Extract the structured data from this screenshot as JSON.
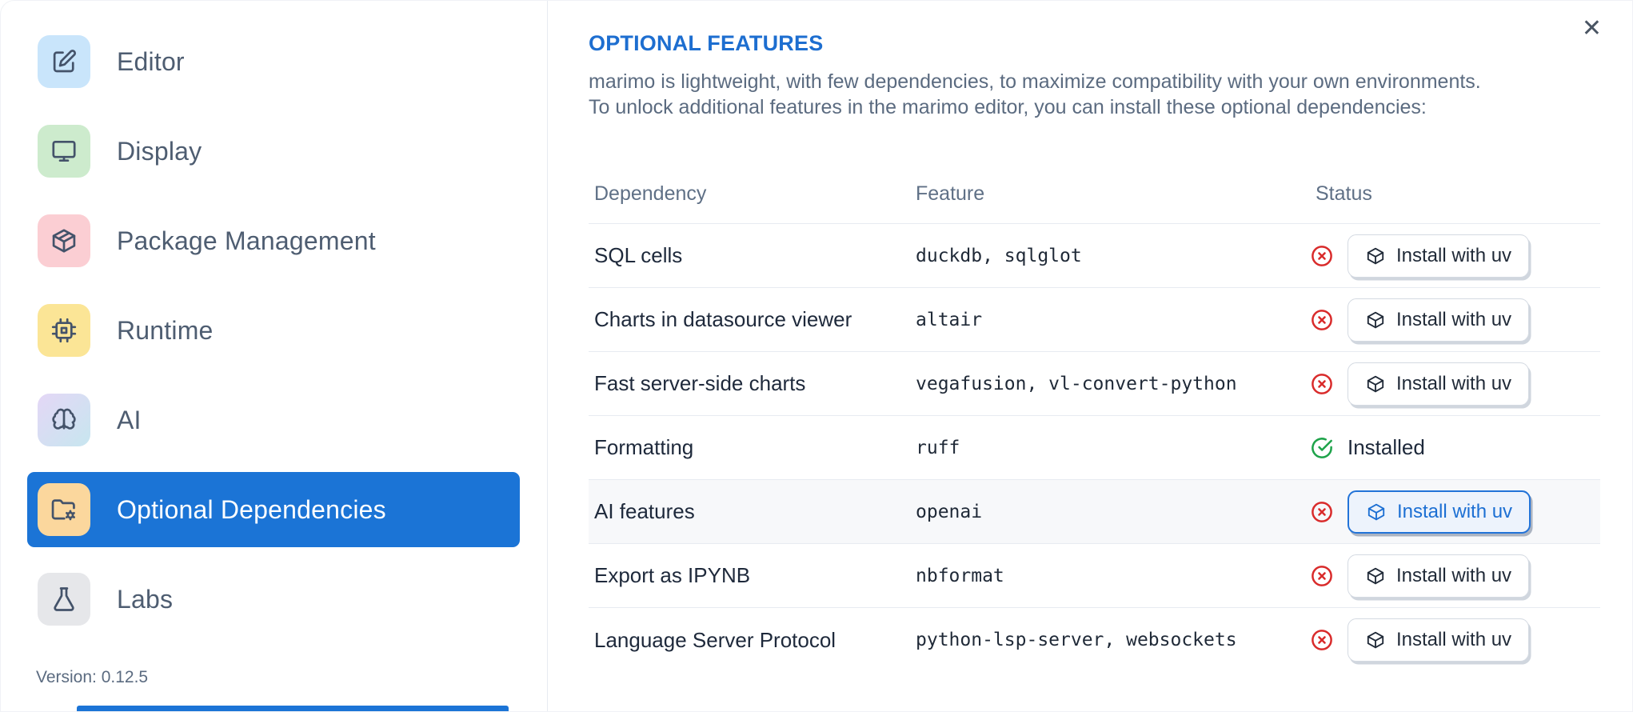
{
  "sidebar": {
    "items": [
      {
        "label": "Editor",
        "icon": "edit-icon",
        "icon_bg": "#c9e5fb",
        "selected": false
      },
      {
        "label": "Display",
        "icon": "monitor-icon",
        "icon_bg": "#cdebcd",
        "selected": false
      },
      {
        "label": "Package Management",
        "icon": "package-icon",
        "icon_bg": "#fbced3",
        "selected": false
      },
      {
        "label": "Runtime",
        "icon": "cpu-icon",
        "icon_bg": "#fbe596",
        "selected": false
      },
      {
        "label": "AI",
        "icon": "brain-icon",
        "icon_bg": "linear-gradient(135deg,#e4d7f6,#c7e6ef)",
        "selected": false
      },
      {
        "label": "Optional Dependencies",
        "icon": "folder-gear-icon",
        "icon_bg": "#fbd79d",
        "selected": true
      },
      {
        "label": "Labs",
        "icon": "flask-icon",
        "icon_bg": "#e6e7ea",
        "selected": false
      }
    ],
    "version_label": "Version: 0.12.5"
  },
  "dialog": {
    "title": "OPTIONAL FEATURES",
    "description_line1": "marimo is lightweight, with few dependencies, to maximize compatibility with your own environments.",
    "description_line2": "To unlock additional features in the marimo editor, you can install these optional dependencies:",
    "close_glyph": "✕"
  },
  "table": {
    "headers": [
      "Dependency",
      "Feature",
      "Status"
    ],
    "install_action_label": "Install with uv",
    "installed_label": "Installed",
    "rows": [
      {
        "dependency": "SQL cells",
        "feature": "duckdb, sqlglot",
        "installed": false,
        "highlighted": false
      },
      {
        "dependency": "Charts in datasource viewer",
        "feature": "altair",
        "installed": false,
        "highlighted": false
      },
      {
        "dependency": "Fast server-side charts",
        "feature": "vegafusion, vl-convert-python",
        "installed": false,
        "highlighted": false
      },
      {
        "dependency": "Formatting",
        "feature": "ruff",
        "installed": true,
        "highlighted": false
      },
      {
        "dependency": "AI features",
        "feature": "openai",
        "installed": false,
        "highlighted": true
      },
      {
        "dependency": "Export as IPYNB",
        "feature": "nbformat",
        "installed": false,
        "highlighted": false
      },
      {
        "dependency": "Language Server Protocol",
        "feature": "python-lsp-server, websockets",
        "installed": false,
        "highlighted": false
      }
    ]
  },
  "colors": {
    "accent_blue": "#1b74d6",
    "heading_blue": "#1d6ed0",
    "danger_red": "#d92b2b",
    "success_green": "#1ea34a",
    "sidebar_text": "#4e5d71",
    "body_text": "#5b6b80",
    "cell_text": "#1e293b",
    "divider": "#e7ebf1",
    "highlight_btn_bg": "#edf3fc",
    "row_highlight_bg": "#f7f8fa"
  }
}
